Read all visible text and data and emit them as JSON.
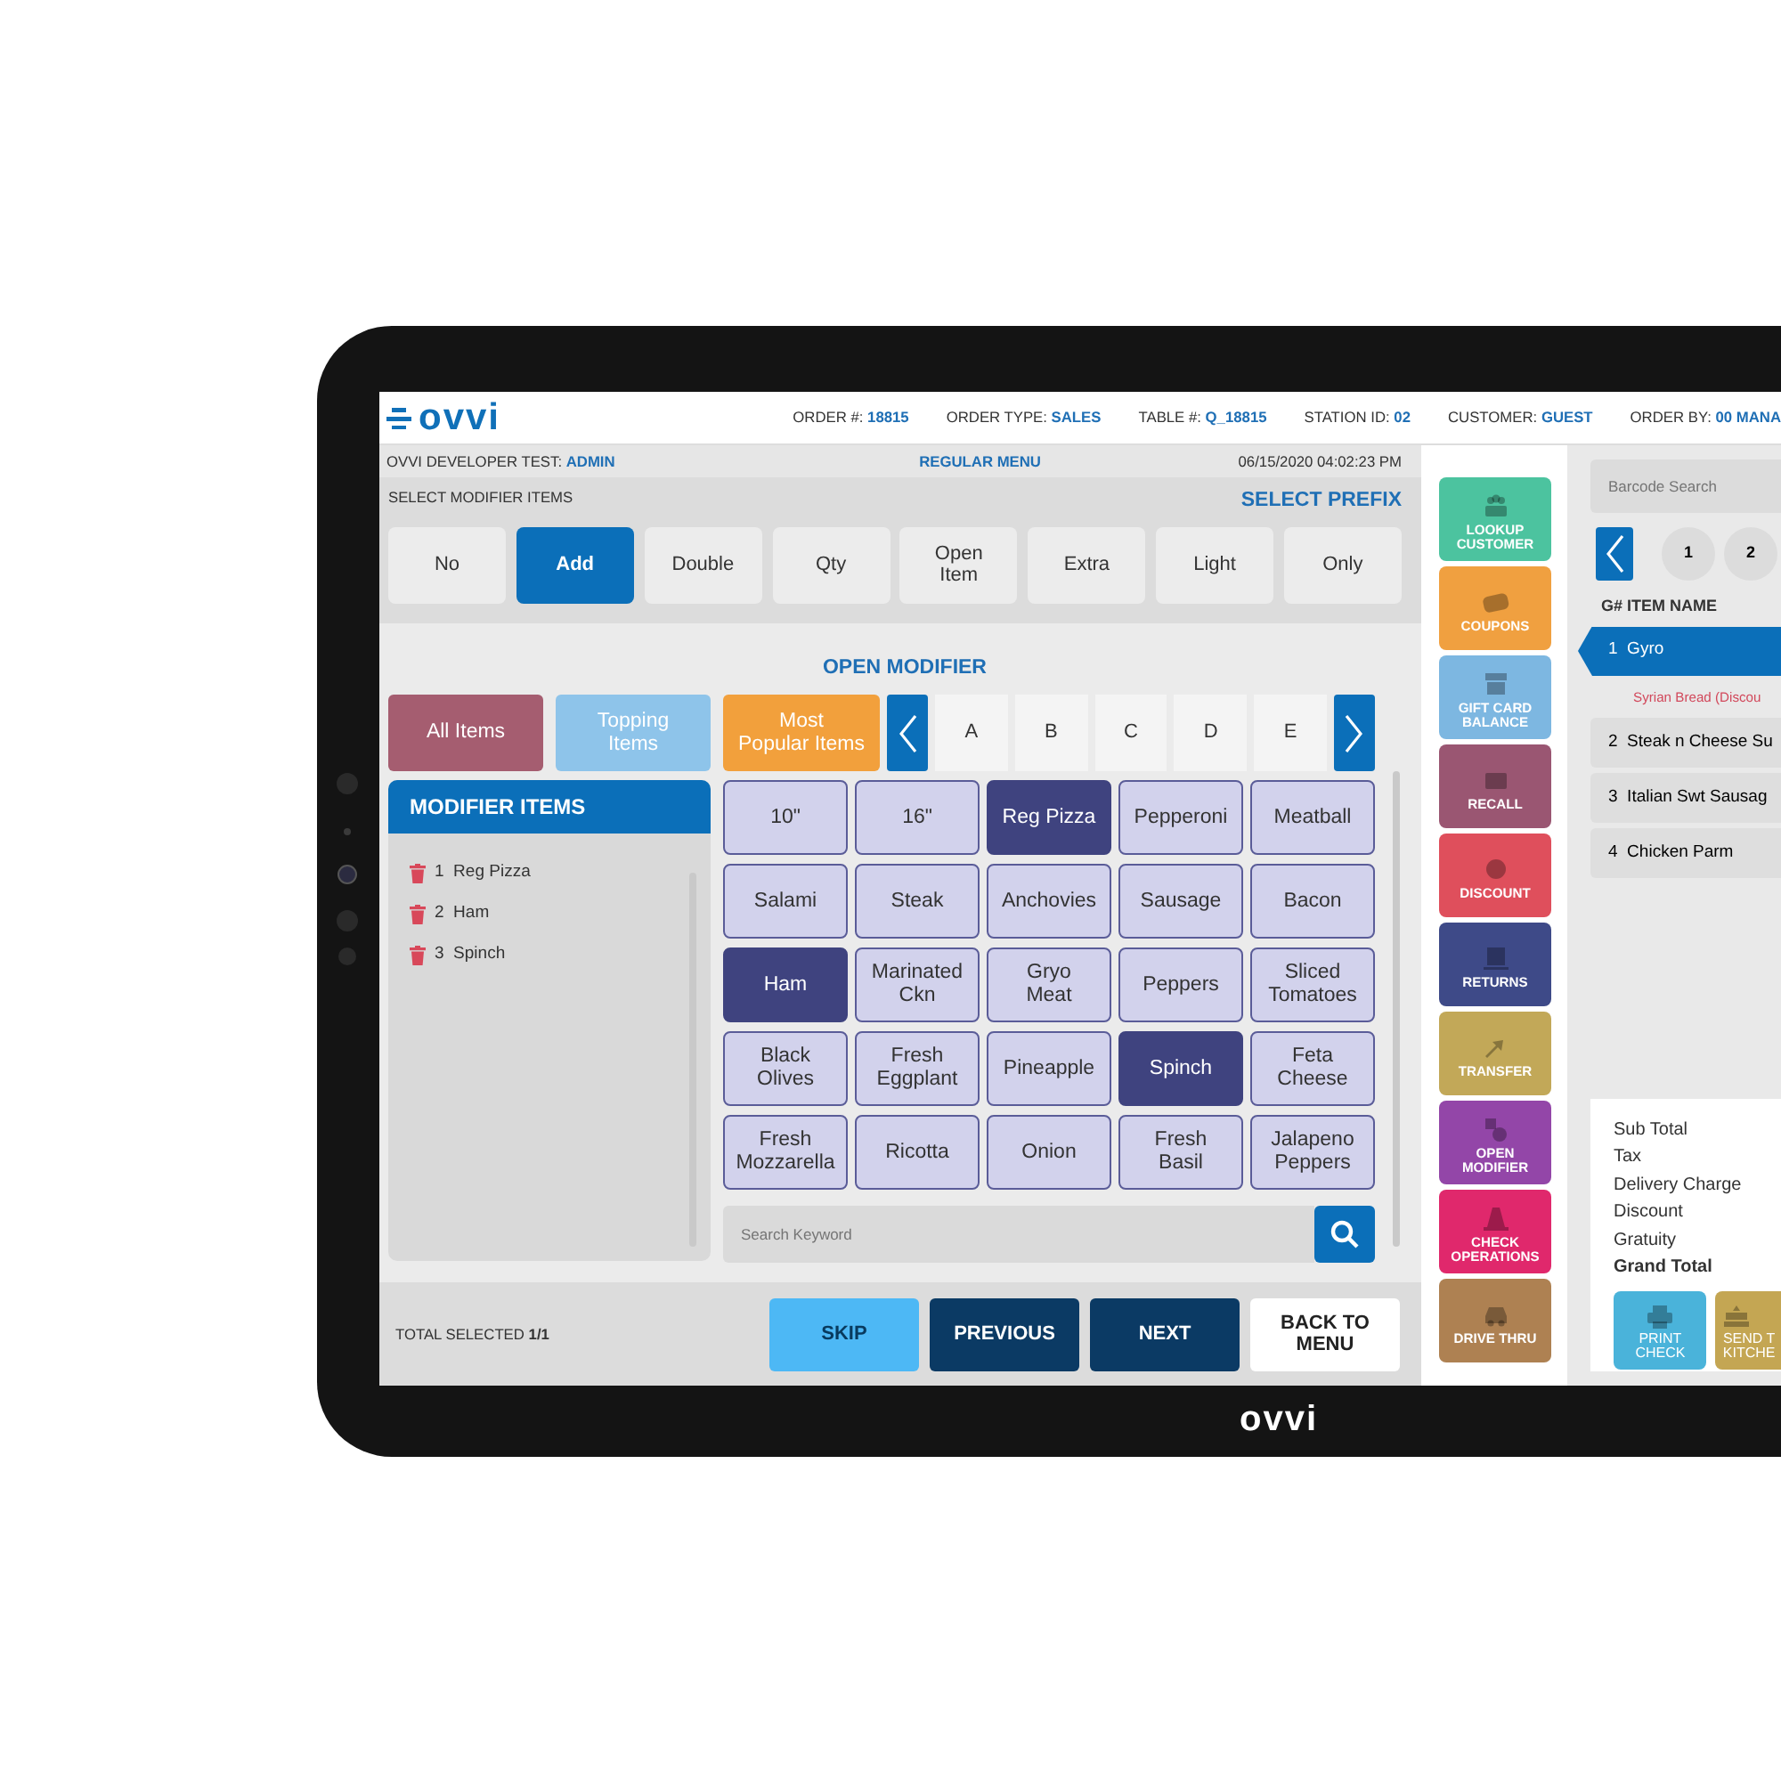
{
  "header": {
    "logo": "ovvi",
    "fields": [
      {
        "label": "ORDER #:",
        "value": "18815"
      },
      {
        "label": "ORDER TYPE:",
        "value": "SALES"
      },
      {
        "label": "TABLE #:",
        "value": "Q_18815"
      },
      {
        "label": "STATION ID:",
        "value": "02"
      },
      {
        "label": "CUSTOMER:",
        "value": "GUEST"
      },
      {
        "label": "ORDER BY:",
        "value": "00 MANA"
      }
    ]
  },
  "info_bar": {
    "user_label": "OVVI DEVELOPER TEST:",
    "user": "ADMIN",
    "menu": "REGULAR MENU",
    "datetime": "06/15/2020 04:02:23 PM"
  },
  "prefix": {
    "title": "SELECT MODIFIER ITEMS",
    "link": "SELECT PREFIX",
    "buttons": [
      {
        "label": "No",
        "selected": false
      },
      {
        "label": "Add",
        "selected": true
      },
      {
        "label": "Double",
        "selected": false
      },
      {
        "label": "Qty",
        "selected": false
      },
      {
        "label": "Open\nItem",
        "selected": false
      },
      {
        "label": "Extra",
        "selected": false
      },
      {
        "label": "Light",
        "selected": false
      },
      {
        "label": "Only",
        "selected": false
      }
    ]
  },
  "open_modifier": {
    "title": "OPEN MODIFIER",
    "categories": [
      {
        "label": "All Items",
        "color": "#a55d70"
      },
      {
        "label": "Topping\nItems",
        "color": "#8ec4ea"
      },
      {
        "label": "Most\nPopular Items",
        "color": "#f2a03c"
      }
    ],
    "letters": [
      "A",
      "B",
      "C",
      "D",
      "E"
    ],
    "panel": {
      "title": "MODIFIER ITEMS",
      "items": [
        {
          "number": "1",
          "name": "Reg Pizza"
        },
        {
          "number": "2",
          "name": "Ham"
        },
        {
          "number": "3",
          "name": "Spinch"
        }
      ]
    },
    "modifiers": [
      {
        "label": "10\"",
        "selected": false
      },
      {
        "label": "16\"",
        "selected": false
      },
      {
        "label": "Reg Pizza",
        "selected": true
      },
      {
        "label": "Pepperoni",
        "selected": false
      },
      {
        "label": "Meatball",
        "selected": false
      },
      {
        "label": "Salami",
        "selected": false
      },
      {
        "label": "Steak",
        "selected": false
      },
      {
        "label": "Anchovies",
        "selected": false
      },
      {
        "label": "Sausage",
        "selected": false
      },
      {
        "label": "Bacon",
        "selected": false
      },
      {
        "label": "Ham",
        "selected": true
      },
      {
        "label": "Marinated\nCkn",
        "selected": false
      },
      {
        "label": "Gryo\nMeat",
        "selected": false
      },
      {
        "label": "Peppers",
        "selected": false
      },
      {
        "label": "Sliced\nTomatoes",
        "selected": false
      },
      {
        "label": "Black\nOlives",
        "selected": false
      },
      {
        "label": "Fresh\nEggplant",
        "selected": false
      },
      {
        "label": "Pineapple",
        "selected": false
      },
      {
        "label": "Spinch",
        "selected": true
      },
      {
        "label": "Feta\nCheese",
        "selected": false
      },
      {
        "label": "Fresh\nMozzarella",
        "selected": false
      },
      {
        "label": "Ricotta",
        "selected": false
      },
      {
        "label": "Onion",
        "selected": false
      },
      {
        "label": "Fresh\nBasil",
        "selected": false
      },
      {
        "label": "Jalapeno\nPeppers",
        "selected": false
      }
    ],
    "search": {
      "placeholder": "Search Keyword"
    }
  },
  "footer": {
    "total_label": "TOTAL SELECTED",
    "total": "1/1",
    "buttons": [
      {
        "label": "SKIP",
        "kind": "light"
      },
      {
        "label": "PREVIOUS",
        "kind": "dark"
      },
      {
        "label": "NEXT",
        "kind": "dark"
      },
      {
        "label": "BACK TO\nMENU",
        "kind": "plain"
      }
    ]
  },
  "actions": [
    {
      "label": "LOOKUP\nCUSTOMER",
      "color": "#4cc39f"
    },
    {
      "label": "COUPONS",
      "color": "#f0a040"
    },
    {
      "label": "GIFT CARD\nBALANCE",
      "color": "#7db7e1"
    },
    {
      "label": "RECALL",
      "color": "#9a5672"
    },
    {
      "label": "DISCOUNT",
      "color": "#df4f5c"
    },
    {
      "label": "RETURNS",
      "color": "#3e4a88"
    },
    {
      "label": "TRANSFER",
      "color": "#c2a858"
    },
    {
      "label": "OPEN\nMODIFIER",
      "color": "#9346a8"
    },
    {
      "label": "CHECK\nOPERATIONS",
      "color": "#e0286c"
    },
    {
      "label": "DRIVE THRU",
      "color": "#ae8152"
    }
  ],
  "order": {
    "barcode_placeholder": "Barcode Search",
    "pages": [
      "1",
      "2"
    ],
    "columns_title": "G# ITEM NAME",
    "lines": [
      {
        "number": "1",
        "name": "Gyro",
        "selected": true,
        "modifiers": [
          "Syrian Bread (Discou"
        ]
      },
      {
        "number": "2",
        "name": "Steak n Cheese Su",
        "selected": false
      },
      {
        "number": "3",
        "name": "Italian Swt Sausag",
        "selected": false
      },
      {
        "number": "4",
        "name": "Chicken Parm",
        "selected": false
      }
    ],
    "totals": [
      {
        "label": "Sub Total",
        "kind": "line"
      },
      {
        "label": "Tax",
        "kind": "line"
      },
      {
        "label": "Delivery Charge",
        "kind": "line"
      },
      {
        "label": "Discount",
        "kind": "line"
      },
      {
        "label": "Gratuity",
        "kind": "line"
      },
      {
        "label": "Grand Total",
        "kind": "grand"
      }
    ],
    "buttons": [
      {
        "label": "PRINT\nCHECK",
        "color": "#4ab3da"
      },
      {
        "label": "SEND T\nKITCHE",
        "color": "#c4a653"
      }
    ]
  },
  "device": {
    "logo": "ovvi"
  }
}
